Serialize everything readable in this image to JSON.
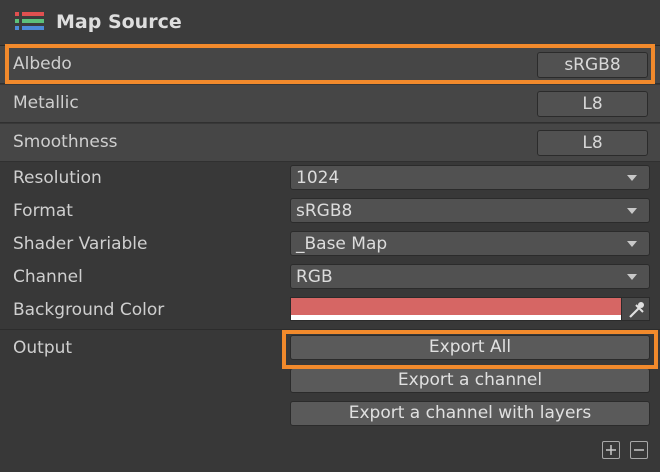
{
  "header": {
    "title": "Map Source",
    "icon": "list-icon"
  },
  "maps": [
    {
      "label": "Albedo",
      "format": "sRGB8",
      "selected": true
    },
    {
      "label": "Metallic",
      "format": "L8",
      "selected": false
    },
    {
      "label": "Smoothness",
      "format": "L8",
      "selected": false
    }
  ],
  "settings": {
    "resolution": {
      "label": "Resolution",
      "value": "1024"
    },
    "format": {
      "label": "Format",
      "value": "sRGB8"
    },
    "shader_variable": {
      "label": "Shader Variable",
      "value": "_Base Map"
    },
    "channel": {
      "label": "Channel",
      "value": "RGB"
    },
    "background_color": {
      "label": "Background Color",
      "color": "#d66664"
    }
  },
  "output": {
    "label": "Output",
    "export_all": "Export All",
    "export_channel": "Export a channel",
    "export_channel_layers": "Export a channel with layers"
  },
  "footer": {
    "add_icon": "plus-box-icon",
    "remove_icon": "minus-box-icon"
  },
  "colors": {
    "highlight": "#f28a2c",
    "panel": "#383838",
    "row": "#464646"
  }
}
